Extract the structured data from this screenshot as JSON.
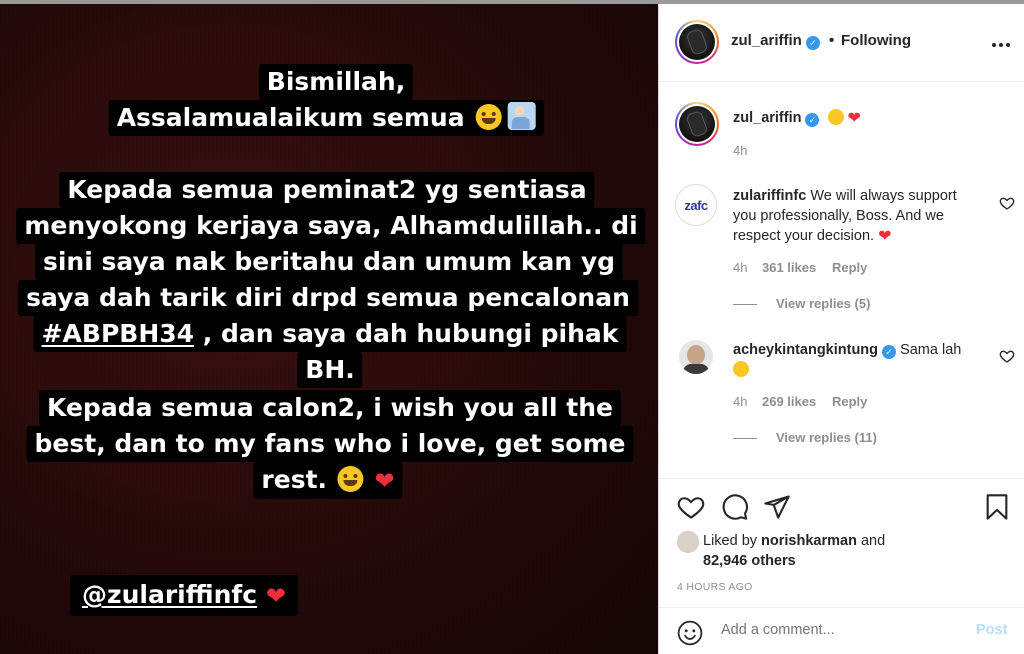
{
  "story": {
    "lines": [
      "Bismillah,",
      "Assalamualaikum semua",
      "Kepada semua peminat2 yg sentiasa",
      "menyokong kerjaya saya, Alhamdulillah.. di",
      "sini saya nak beritahu dan umum kan yg",
      "saya dah tarik diri drpd semua pencalonan",
      "#ABPBH34",
      ", dan saya dah hubungi pihak",
      "BH.",
      "Kepada semua calon2, i wish you all the",
      "best, dan to my fans who i love, get some",
      "rest."
    ],
    "mention": "@zulariffinfc"
  },
  "header": {
    "username": "zul_ariffin",
    "separator": "•",
    "follow_state": "Following"
  },
  "caption": {
    "username": "zul_ariffin",
    "time": "4h"
  },
  "comments": [
    {
      "username": "zulariffinfc",
      "text_line1": "We will always support",
      "text_line2": "you professionally, Boss. And we",
      "text_line3": "respect your decision.",
      "avatar_text": "zafc",
      "time": "4h",
      "likes": "361 likes",
      "reply": "Reply",
      "view_replies": "View replies (5)"
    },
    {
      "username": "acheykintangkintung",
      "text": "Sama lah",
      "time": "4h",
      "likes": "269 likes",
      "reply": "Reply",
      "view_replies": "View replies (11)"
    }
  ],
  "likes": {
    "prefix": "Liked by",
    "user": "norishkarman",
    "and": "and",
    "others": "82,946 others"
  },
  "post_time": "4 HOURS AGO",
  "add_comment": {
    "placeholder": "Add a comment...",
    "post_label": "Post"
  },
  "colors": {
    "verified": "#3897f0",
    "heart": "#ed2e3d",
    "post_disabled": "#b2dffc"
  }
}
